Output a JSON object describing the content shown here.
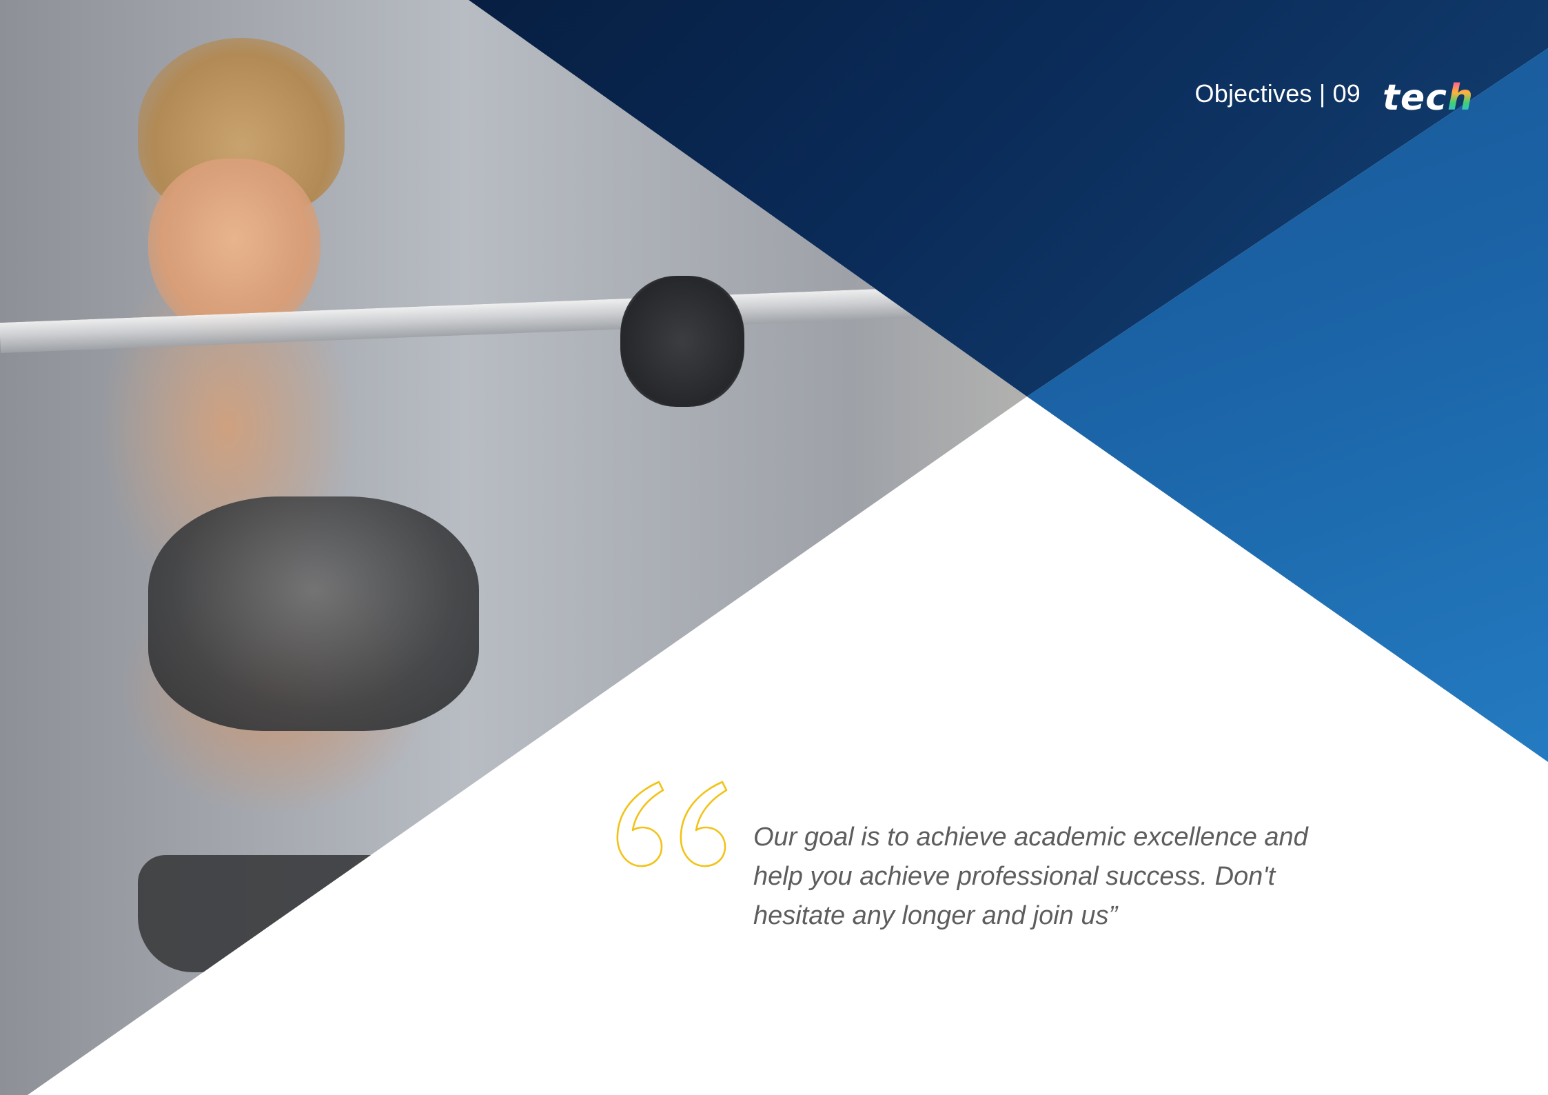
{
  "header": {
    "section_title": "Objectives | 09",
    "logo_text": "tec",
    "logo_accent": "h"
  },
  "quote": {
    "text": "Our goal is to achieve academic excellence and help you achieve professional success. Don't hesitate any longer and join us”",
    "mark_icon": "open-quote-icon",
    "mark_color": "#f2c316"
  },
  "colors": {
    "dark_blue": "#041530",
    "mid_blue": "#1b64a7",
    "light_blue": "#2a8ad2",
    "body_text": "#5d5d5d"
  },
  "background_image": {
    "subject": "woman-with-barbell-photo"
  }
}
